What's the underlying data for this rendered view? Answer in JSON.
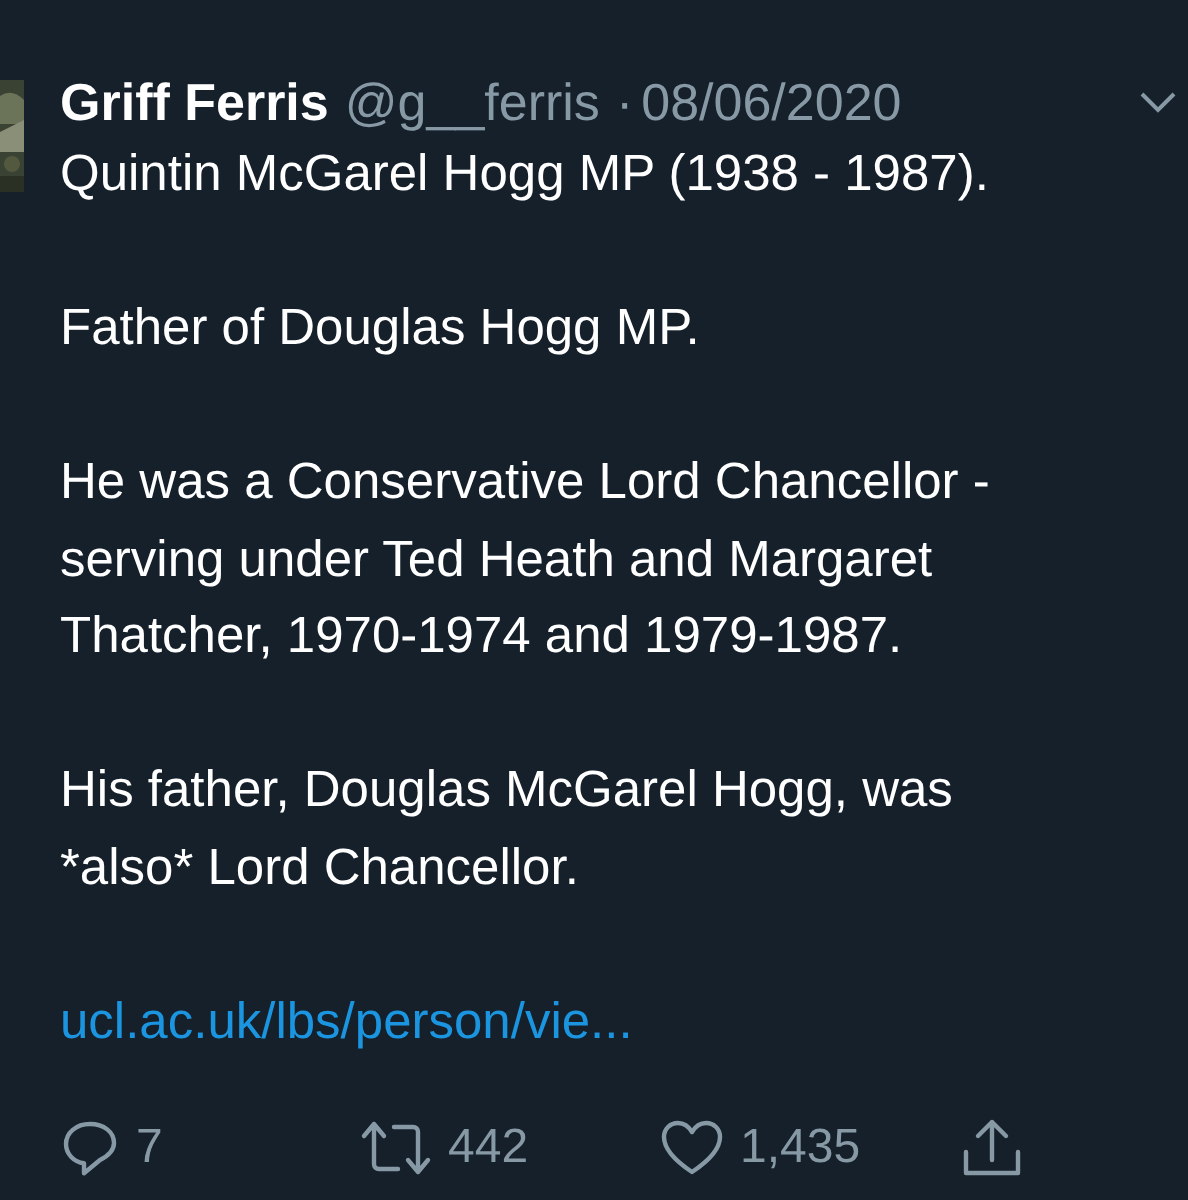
{
  "author": {
    "name": "Griff Ferris",
    "handle": "@g__ferris",
    "separator": "·",
    "date": "08/06/2020"
  },
  "paragraphs": [
    {
      "lines": [
        "Quintin McGarel Hogg MP (1938 - 1987)."
      ]
    },
    {
      "lines": [
        "Father of Douglas Hogg MP."
      ]
    },
    {
      "lines": [
        "He was a Conservative Lord Chancellor -",
        "serving under Ted Heath and Margaret",
        "Thatcher, 1970-1974 and 1979-1987."
      ]
    },
    {
      "lines": [
        "His father, Douglas McGarel Hogg, was",
        "*also* Lord Chancellor."
      ]
    }
  ],
  "link": "ucl.ac.uk/lbs/person/vie...",
  "actions": [
    {
      "kind": "reply",
      "count": "7"
    },
    {
      "kind": "retweet",
      "count": "442"
    },
    {
      "kind": "like",
      "count": "1,435"
    },
    {
      "kind": "share"
    }
  ]
}
